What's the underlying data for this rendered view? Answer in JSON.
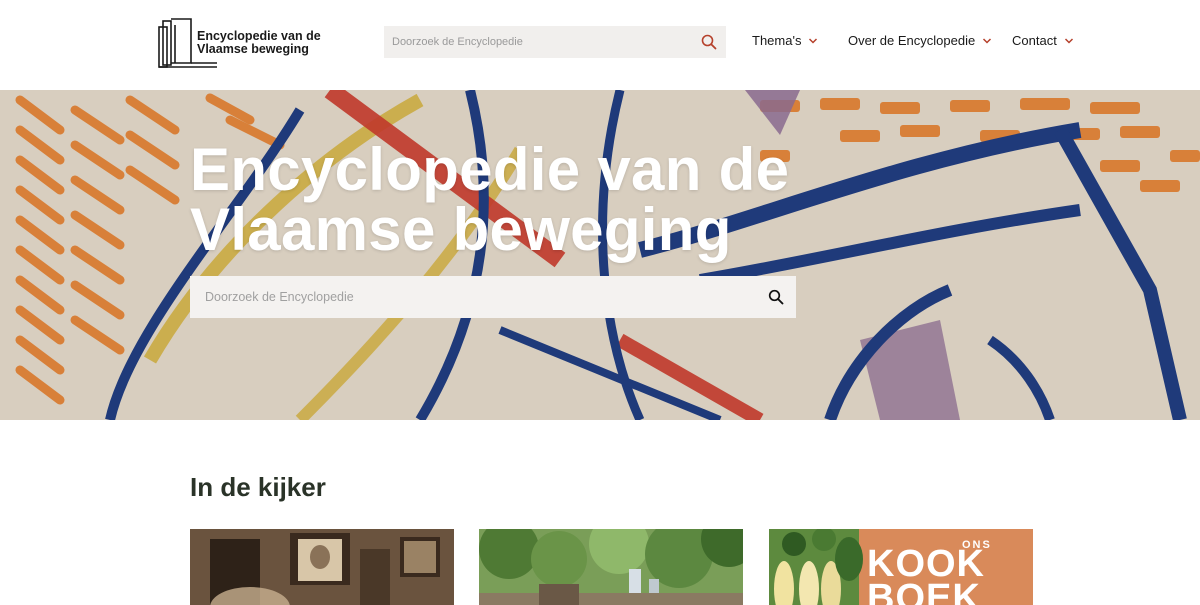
{
  "header": {
    "logo": {
      "line1": "Encyclopedie van de",
      "line2": "Vlaamse beweging"
    },
    "search": {
      "placeholder": "Doorzoek de Encyclopedie",
      "icon": "search-icon"
    },
    "nav": [
      {
        "label": "Thema's",
        "icon": "chevron-down-icon"
      },
      {
        "label": "Over de Encyclopedie",
        "icon": "chevron-down-icon"
      },
      {
        "label": "Contact",
        "icon": "chevron-down-icon"
      }
    ],
    "accent_color": "#b5402b"
  },
  "hero": {
    "title_line1": "Encyclopedie van de",
    "title_line2": "Vlaamse beweging",
    "search": {
      "placeholder": "Doorzoek de Encyclopedie",
      "icon": "search-icon"
    }
  },
  "section": {
    "title": "In de kijker",
    "cards": [
      {
        "image": "sepia-portrait-photo"
      },
      {
        "image": "trees-park-photo"
      },
      {
        "image": "cookbook-cover",
        "cover_text_1": "ONS",
        "cover_text_2": "KOOK",
        "cover_text_3": "BOEK"
      }
    ]
  }
}
